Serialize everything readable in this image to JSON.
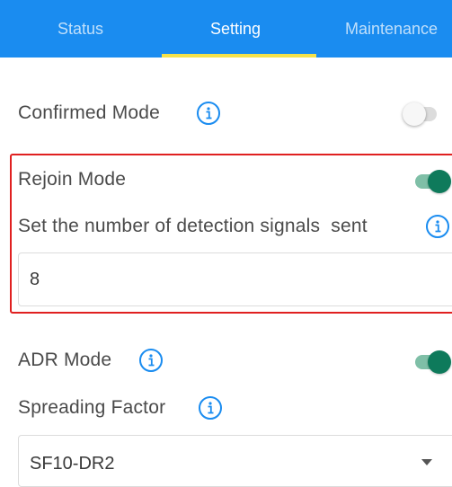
{
  "tabs": {
    "items": [
      {
        "label": "Status",
        "active": false
      },
      {
        "label": "Setting",
        "active": true
      },
      {
        "label": "Maintenance",
        "active": false
      }
    ]
  },
  "settings": {
    "confirmed_mode": {
      "label": "Confirmed Mode",
      "enabled": false,
      "info_icon": "info-icon"
    },
    "rejoin_mode": {
      "label": "Rejoin Mode",
      "enabled": true
    },
    "detection_signals": {
      "label": "Set the number of detection signals  sent",
      "value": "8",
      "info_icon": "info-icon"
    },
    "adr_mode": {
      "label": "ADR Mode",
      "enabled": true,
      "info_icon": "info-icon"
    },
    "spreading_factor": {
      "label": "Spreading Factor",
      "selected": "SF10-DR2",
      "info_icon": "info-icon"
    }
  },
  "colors": {
    "tab_bar": "#1a8cf0",
    "tab_indicator": "#f5e24a",
    "toggle_on": "#0e7a5b",
    "highlight_border": "#e02020",
    "info_icon": "#1a8cf0"
  }
}
